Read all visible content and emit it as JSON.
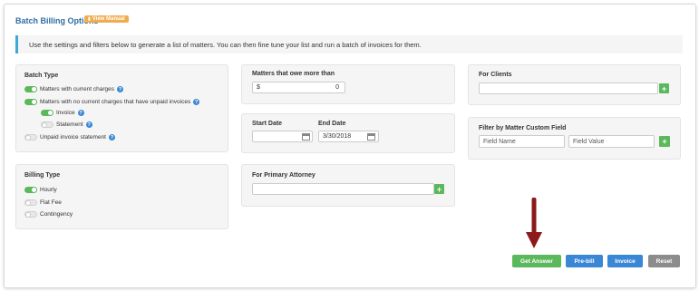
{
  "header": {
    "title": "Batch Billing Options",
    "manual_label": "View Manual"
  },
  "info_text": "Use the settings and filters below to generate a list of matters. You can then fine tune your list and run a batch of invoices for them.",
  "batch_type": {
    "title": "Batch Type",
    "options": [
      {
        "label": "Matters with current charges",
        "on": true
      },
      {
        "label": "Matters with no current charges that have unpaid invoices",
        "on": true
      },
      {
        "label": "Invoice",
        "on": true
      },
      {
        "label": "Statement",
        "on": false
      },
      {
        "label": "Unpaid invoice statement",
        "on": false
      }
    ]
  },
  "billing_type": {
    "title": "Billing Type",
    "options": [
      {
        "label": "Hourly",
        "on": true
      },
      {
        "label": "Flat Fee",
        "on": false
      },
      {
        "label": "Contingency",
        "on": false
      }
    ]
  },
  "owe_more": {
    "title": "Matters that owe more than",
    "currency": "$",
    "value": "0"
  },
  "dates": {
    "start_label": "Start Date",
    "end_label": "End Date",
    "start_value": "",
    "end_value": "3/30/2018"
  },
  "primary_attorney": {
    "title": "For Primary Attorney",
    "value": ""
  },
  "for_clients": {
    "title": "For Clients",
    "value": ""
  },
  "custom_field": {
    "title": "Filter by Matter Custom Field",
    "name_placeholder": "Field Name",
    "value_placeholder": "Field Value"
  },
  "actions": {
    "get_answer": "Get Answer",
    "prebill": "Pre-bill",
    "invoice": "Invoice",
    "reset": "Reset"
  },
  "colors": {
    "green": "#5cb85c",
    "blue": "#3a87d6",
    "grey": "#8c8c8c",
    "orange": "#f0ad4e",
    "arrow": "#8b1a1a"
  }
}
